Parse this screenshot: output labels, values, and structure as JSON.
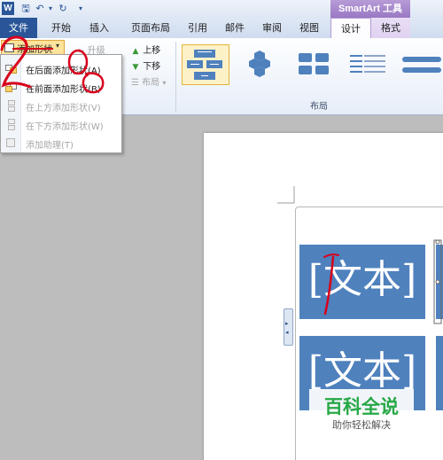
{
  "context_title": "SmartArt 工具",
  "tabs": [
    {
      "label": "文件"
    },
    {
      "label": "开始"
    },
    {
      "label": "插入"
    },
    {
      "label": "页面布局"
    },
    {
      "label": "引用"
    },
    {
      "label": "邮件"
    },
    {
      "label": "审阅"
    },
    {
      "label": "视图"
    },
    {
      "label": "设计"
    },
    {
      "label": "格式"
    }
  ],
  "ribbon": {
    "add_shape_label": "添加形状",
    "promote_label": "升级",
    "move_up_label": "上移",
    "move_down_label": "下移",
    "layout_label": "布局",
    "group_layout_label": "布局"
  },
  "dropdown": {
    "items": [
      {
        "label": "在后面添加形状(A)",
        "enabled": true
      },
      {
        "label": "在前面添加形状(B)",
        "enabled": true
      },
      {
        "label": "在上方添加形状(V)",
        "enabled": false
      },
      {
        "label": "在下方添加形状(W)",
        "enabled": false
      },
      {
        "label": "添加助理(T)",
        "enabled": false
      }
    ]
  },
  "smartart": {
    "placeholder_text": "[文本]"
  },
  "watermark": {
    "title": "百科全说",
    "subtitle": "助你轻松解决"
  },
  "colors": {
    "file_tab": "#2a5699",
    "smartart_shape": "#4f81bd",
    "context_tab": "#9a78c4",
    "annotation_red": "#d9001b",
    "watermark_green": "#27a845"
  }
}
